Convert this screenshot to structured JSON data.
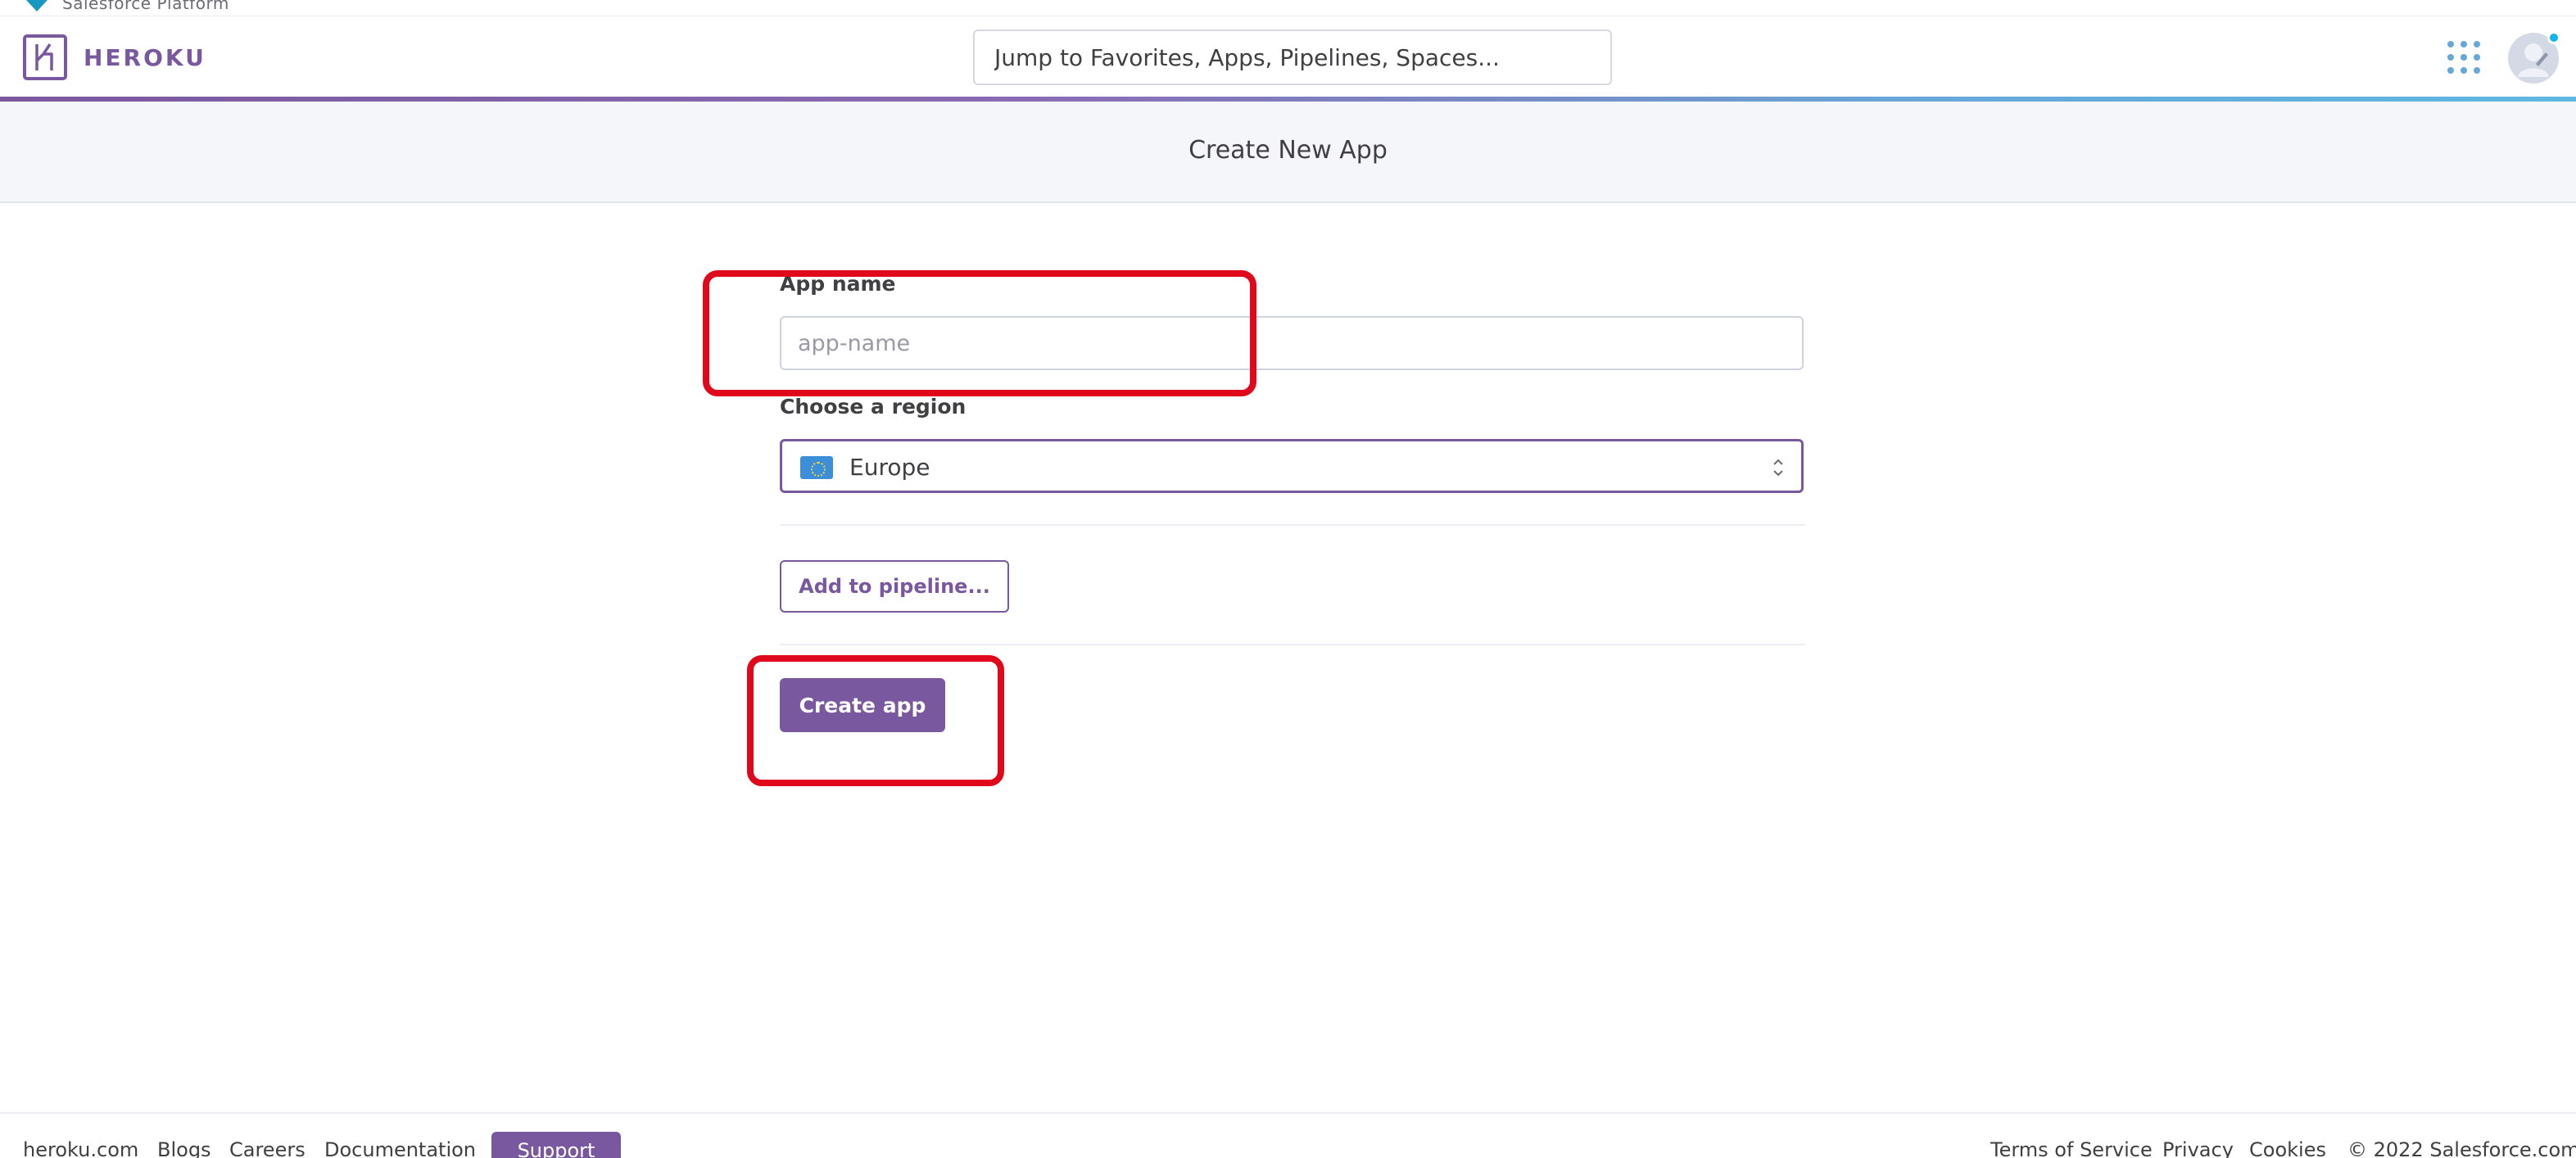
{
  "salesforce_strip": {
    "text": "Salesforce Platform"
  },
  "header": {
    "brand": "HEROKU",
    "search_placeholder": "Jump to Favorites, Apps, Pipelines, Spaces...",
    "apps_icon": "grid-dots-icon",
    "avatar_icon": "user-avatar-icon"
  },
  "subheader": {
    "title": "Create New App"
  },
  "form": {
    "app_name_label": "App name",
    "app_name_placeholder": "app-name",
    "app_name_value": "",
    "region_label": "Choose a region",
    "region_value": "Europe",
    "region_flag_icon": "eu-flag-icon",
    "add_pipeline_label": "Add to pipeline...",
    "create_label": "Create app"
  },
  "footer": {
    "links_left": [
      "heroku.com",
      "Blogs",
      "Careers",
      "Documentation"
    ],
    "support_label": "Support",
    "links_right": [
      "Terms of Service",
      "Privacy",
      "Cookies",
      "© 2022 Salesforce.com"
    ]
  },
  "colors": {
    "brand_purple": "#79589f",
    "accent_blue": "#67a8d8",
    "highlight_red": "#e0091b",
    "subheader_bg": "#f5f6fa"
  }
}
